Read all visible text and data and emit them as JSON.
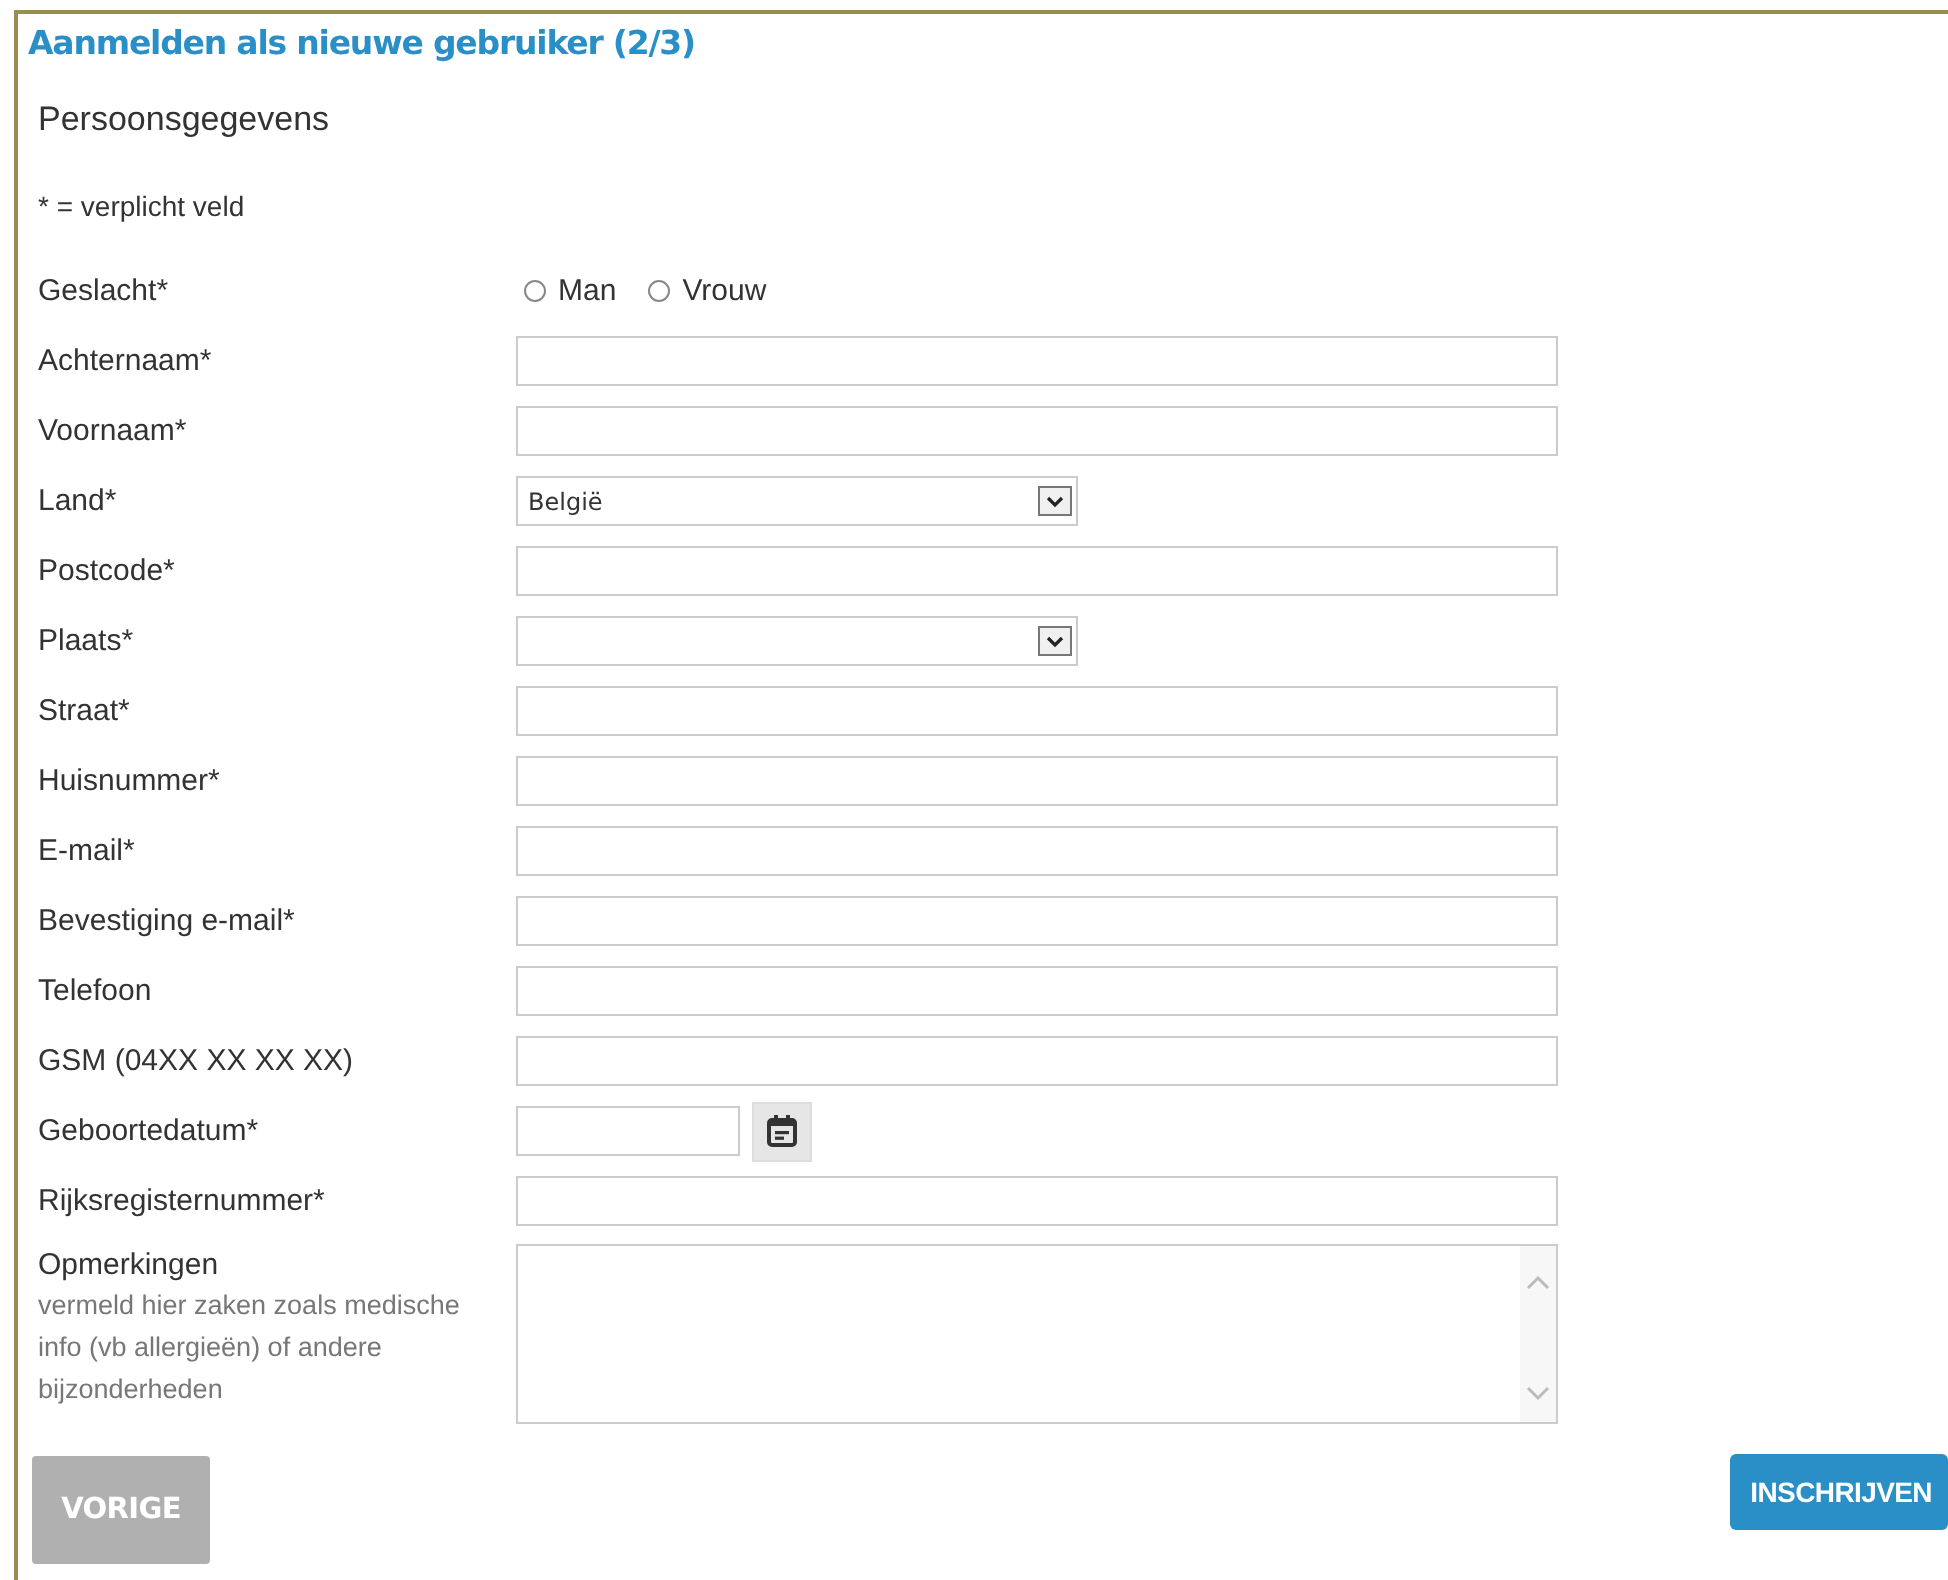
{
  "title": "Aanmelden als nieuwe gebruiker (2/3)",
  "section": "Persoonsgegevens",
  "required_note": "* = verplicht veld",
  "fields": [
    {
      "kind": "radio",
      "label": "Geslacht*",
      "options": [
        {
          "label": "Man",
          "selected": false
        },
        {
          "label": "Vrouw",
          "selected": false
        }
      ]
    },
    {
      "kind": "text",
      "label": "Achternaam*"
    },
    {
      "kind": "text",
      "label": "Voornaam*"
    },
    {
      "kind": "select",
      "label": "Land*",
      "value": "België"
    },
    {
      "kind": "text",
      "label": "Postcode*"
    },
    {
      "kind": "select",
      "label": "Plaats*"
    },
    {
      "kind": "text",
      "label": "Straat*"
    },
    {
      "kind": "text",
      "label": "Huisnummer*"
    },
    {
      "kind": "text",
      "label": "E-mail*"
    },
    {
      "kind": "text",
      "label": "Bevestiging e-mail*"
    },
    {
      "kind": "text",
      "label": "Telefoon"
    },
    {
      "kind": "text",
      "label": "GSM (04XX XX XX XX)"
    },
    {
      "kind": "date",
      "label": "Geboortedatum*"
    },
    {
      "kind": "text",
      "label": "Rijksregisternummer*"
    },
    {
      "kind": "textarea",
      "label": "Opmerkingen",
      "hint": "vermeld hier zaken zoals medische info (vb allergieën) of andere bijzonderheden"
    }
  ],
  "buttons": [
    {
      "kind": "back",
      "label": "VORIGE"
    },
    {
      "kind": "submit",
      "label": "INSCHRIJVEN"
    }
  ]
}
